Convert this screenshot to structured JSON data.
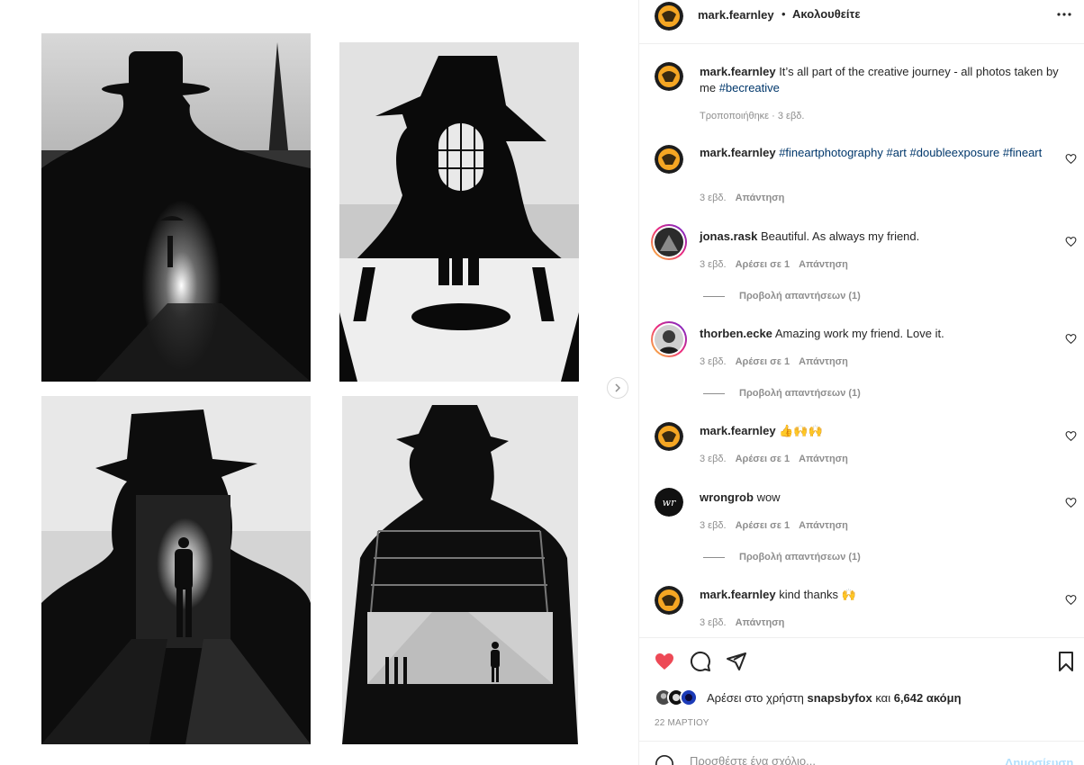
{
  "post": {
    "author": "mark.fearnley",
    "follow_dot": "•",
    "follow_label": "Ακολουθείτε"
  },
  "caption": {
    "user": "mark.fearnley",
    "text": "It’s all part of the creative journey - all photos taken by me",
    "hashtag": "#becreative",
    "edited": "Τροποποιήθηκε · 3 εβδ."
  },
  "comments": [
    {
      "user": "mark.fearnley",
      "text": "",
      "tags": [
        "#fineartphotography",
        "#art",
        "#doubleexposure",
        "#fineart"
      ],
      "time": "3 εβδ.",
      "likes": "",
      "reply": "Απάντηση",
      "view_replies": ""
    },
    {
      "user": "jonas.rask",
      "text": "Beautiful. As always my friend.",
      "time": "3 εβδ.",
      "likes": "Αρέσει σε 1",
      "reply": "Απάντηση",
      "view_replies": "Προβολή απαντήσεων (1)"
    },
    {
      "user": "thorben.ecke",
      "text": "Amazing work my friend. Love it.",
      "time": "3 εβδ.",
      "likes": "Αρέσει σε 1",
      "reply": "Απάντηση",
      "view_replies": "Προβολή απαντήσεων (1)"
    },
    {
      "user": "mark.fearnley",
      "text": "👍🙌🙌",
      "time": "3 εβδ.",
      "likes": "Αρέσει σε 1",
      "reply": "Απάντηση",
      "view_replies": ""
    },
    {
      "user": "wrongrob",
      "text": "wow",
      "time": "3 εβδ.",
      "likes": "Αρέσει σε 1",
      "reply": "Απάντηση",
      "view_replies": "Προβολή απαντήσεων (1)"
    },
    {
      "user": "mark.fearnley",
      "text": "kind thanks 🙌",
      "time": "3 εβδ.",
      "likes": "",
      "reply": "Απάντηση",
      "view_replies": ""
    }
  ],
  "wrongrob_initials": "wr",
  "likes": {
    "prefix": "Αρέσει στο χρήστη",
    "user": "snapsbyfox",
    "conjunction": "και",
    "count": "6,642 ακόμη"
  },
  "date": "22 ΜΑΡΤΙΟΥ",
  "composer": {
    "placeholder": "Προσθέστε ένα σχόλιο...",
    "post_label": "Δημοσίευση"
  },
  "colors": {
    "like_red": "#ed4956",
    "link_blue": "#00376b",
    "muted": "#8e8e8e"
  },
  "icons": {
    "more": "more-options-icon",
    "heart": "heart-icon",
    "comment": "comment-icon",
    "share": "share-icon",
    "save": "bookmark-icon",
    "next": "chevron-right-icon"
  }
}
